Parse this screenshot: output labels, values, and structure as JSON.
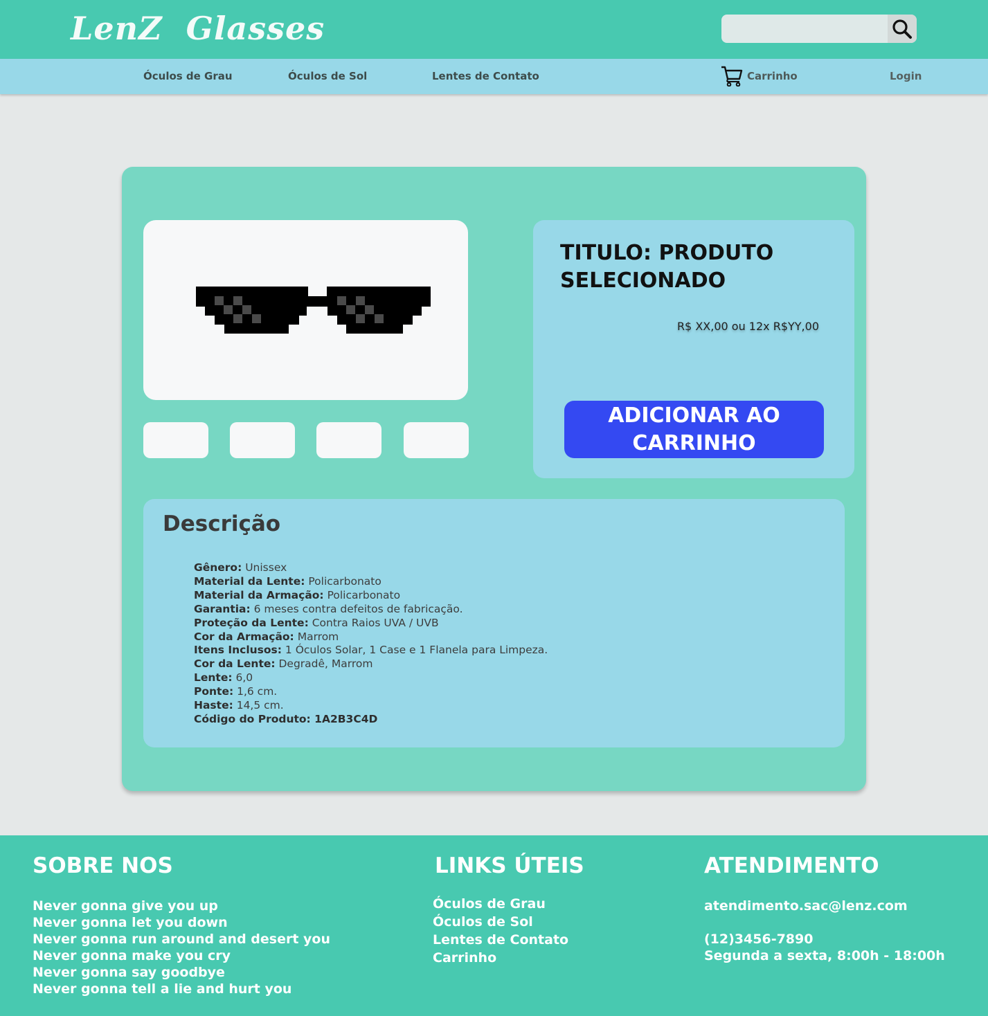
{
  "header": {
    "logo": "LenZ  Glasses",
    "search": {
      "placeholder": "",
      "value": ""
    }
  },
  "nav": {
    "items": [
      "Óculos de Grau",
      "Óculos de Sol",
      "Lentes de Contato"
    ],
    "cart": "Carrinho",
    "login": "Login"
  },
  "product": {
    "title": "TITULO: PRODUTO SELECIONADO",
    "price": "R$ XX,00 ou 12x R$YY,00",
    "add_button": "ADICIONAR AO CARRINHO",
    "thumbnail_count": 4
  },
  "description": {
    "heading": "Descrição",
    "specs": [
      {
        "label": "Gênero:",
        "value": " Unissex"
      },
      {
        "label": "Material da Lente:",
        "value": " Policarbonato"
      },
      {
        "label": "Material da Armação:",
        "value": " Policarbonato"
      },
      {
        "label": "Garantia:",
        "value": " 6 meses contra defeitos de fabricação."
      },
      {
        "label": "Proteção da Lente:",
        "value": " Contra Raios UVA / UVB"
      },
      {
        "label": "Cor da Armação:",
        "value": " Marrom"
      },
      {
        "label": "Itens Inclusos:",
        "value": " 1 Óculos Solar, 1 Case e 1 Flanela para Limpeza."
      },
      {
        "label": "Cor da Lente:",
        "value": " Degradê, Marrom"
      },
      {
        "label": "Lente:",
        "value": " 6,0"
      },
      {
        "label": "Ponte:",
        "value": " 1,6 cm."
      },
      {
        "label": "Haste:",
        "value": " 14,5 cm."
      },
      {
        "label": "Código do Produto:",
        "value": " 1A2B3C4D"
      }
    ]
  },
  "footer": {
    "about": {
      "heading": "SOBRE NOS",
      "lines": [
        "Never gonna give you up",
        "Never gonna let you down",
        "Never gonna run around and desert you",
        "Never gonna make you cry",
        "Never gonna say goodbye",
        "Never gonna tell a lie and hurt you"
      ]
    },
    "links": {
      "heading": "LINKS ÚTEIS",
      "items": [
        "Óculos de Grau",
        "Óculos de Sol",
        "Lentes de Contato",
        "Carrinho"
      ]
    },
    "support": {
      "heading": "ATENDIMENTO",
      "email": "atendimento.sac@lenz.com",
      "phone": "(12)3456-7890",
      "hours": "Segunda a sexta, 8:00h - 18:00h"
    }
  },
  "colors": {
    "header": "#48c9b0",
    "nav": "#98d8e8",
    "card": "#77d7c3",
    "button": "#3449f2",
    "page_bg": "#e5e8e8"
  },
  "icons": [
    "search-icon",
    "cart-icon",
    "sunglasses-image"
  ]
}
